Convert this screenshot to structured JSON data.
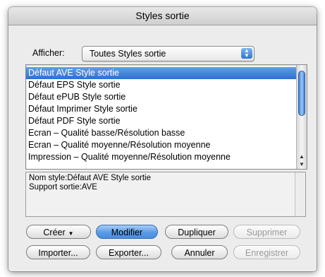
{
  "window": {
    "title": "Styles sortie"
  },
  "filter": {
    "label": "Afficher:",
    "value": "Toutes Styles sortie"
  },
  "styles_list": [
    "Défaut AVE Style sortie",
    "Défaut EPS Style sortie",
    "Défaut ePUB Style sortie",
    "Défaut Imprimer Style sortie",
    "Défaut PDF Style sortie",
    "Ecran – Qualité basse/Résolution basse",
    "Ecran – Qualité moyenne/Résolution moyenne",
    "Impression – Qualité moyenne/Résolution moyenne"
  ],
  "selected_index": 0,
  "info": {
    "line1": "Nom style:Défaut AVE Style sortie",
    "line2": "Support sortie:AVE"
  },
  "buttons": {
    "create": "Créer",
    "modify": "Modifier",
    "duplicate": "Dupliquer",
    "delete": "Supprimer",
    "import": "Importer...",
    "export": "Exporter...",
    "cancel": "Annuler",
    "save": "Enregistrer"
  }
}
